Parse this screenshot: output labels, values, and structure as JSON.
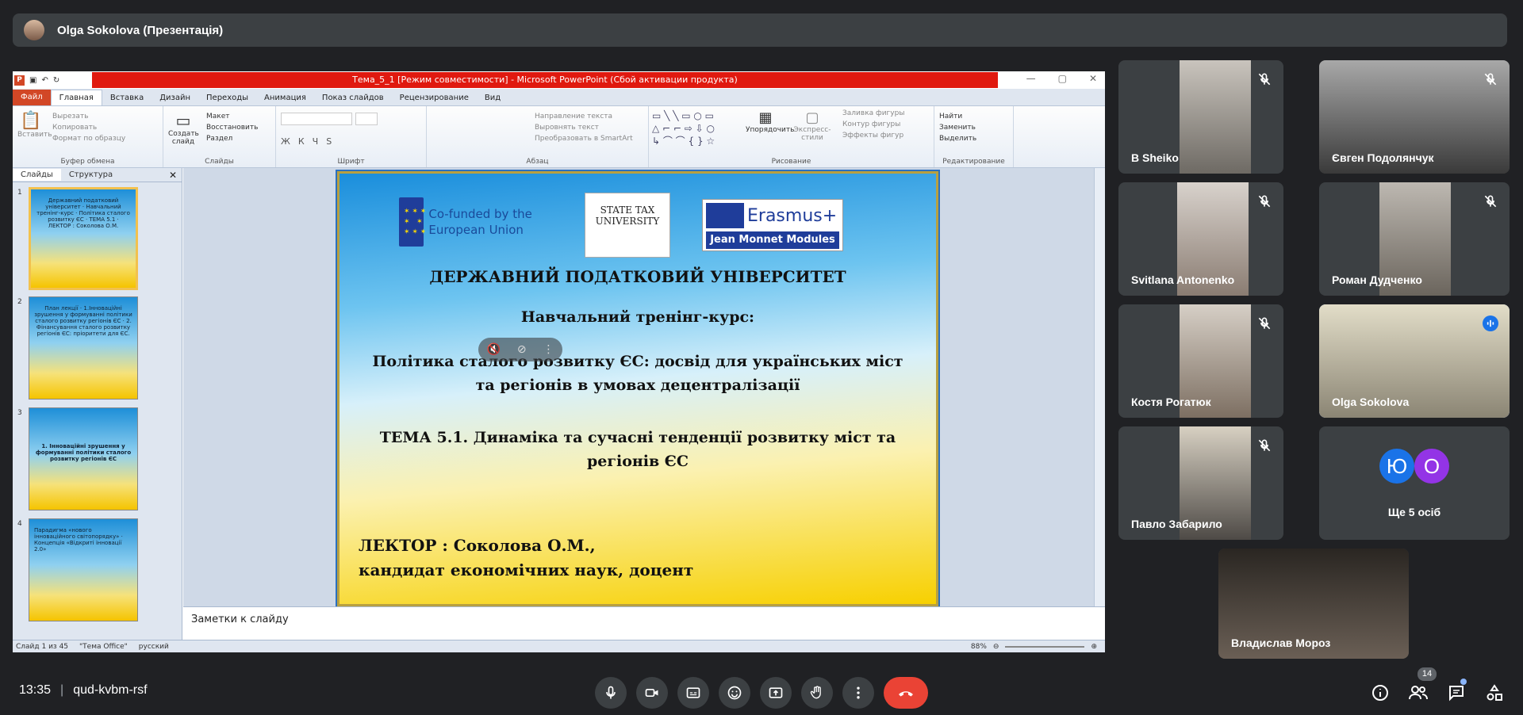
{
  "meeting": {
    "presenter_label": "Olga Sokolova (Презентація)",
    "time": "13:35",
    "code": "qud-kvbm-rsf",
    "people_count": "14"
  },
  "ppt": {
    "window_title": "Тема_5_1 [Режим совместимости] - Microsoft PowerPoint (Сбой активации продукта)",
    "tabs": [
      "Файл",
      "Главная",
      "Вставка",
      "Дизайн",
      "Переходы",
      "Анимация",
      "Показ слайдов",
      "Рецензирование",
      "Вид"
    ],
    "ribbon": {
      "clipboard": {
        "paste": "Вставить",
        "cut": "Вырезать",
        "copy": "Копировать",
        "format": "Формат по образцу",
        "label": "Буфер обмена"
      },
      "slides": {
        "create": "Создать слайд",
        "layout": "Макет",
        "reset": "Восстановить",
        "section": "Раздел",
        "label": "Слайды"
      },
      "font": {
        "label": "Шрифт"
      },
      "paragraph": {
        "direction": "Направление текста",
        "align": "Выровнять текст",
        "smartart": "Преобразовать в SmartArt",
        "label": "Абзац"
      },
      "drawing": {
        "arrange": "Упорядочить",
        "styles": "Экспресс-стили",
        "fill": "Заливка фигуры",
        "outline": "Контур фигуры",
        "effects": "Эффекты фигур",
        "label": "Рисование"
      },
      "editing": {
        "find": "Найти",
        "replace": "Заменить",
        "select": "Выделить",
        "label": "Редактирование"
      }
    },
    "panel_tabs": [
      "Слайды",
      "Структура"
    ],
    "thumbs": [
      {
        "num": "1",
        "text": "Державний податковий університет · Навчальний тренінг-курс · Політика сталого розвитку ЄС · ТЕМА 5.1 · ЛЕКТОР : Соколова О.М."
      },
      {
        "num": "2",
        "text": "План лекції · 1.Інноваційні зрушення у формуванні політики сталого розвитку регіонів ЄС · 2. Фінансування сталого розвитку регіонів ЄС: пріоритети для ЄС."
      },
      {
        "num": "3",
        "text": "1. Інноваційні зрушення у формуванні політики сталого розвитку регіонів ЄС"
      },
      {
        "num": "4",
        "text": "Парадигма «нового інноваційного світопорядку» · Концепція «Відкриті інновації 2.0»"
      }
    ],
    "slide": {
      "eu_logo_text": "Co-funded by the European Union",
      "university_logo": "STATE TAX UNIVERSITY",
      "erasmus_name": "Erasmus+",
      "erasmus_sub": "Jean Monnet Modules",
      "university": "ДЕРЖАВНИЙ ПОДАТКОВИЙ УНІВЕРСИТЕТ",
      "course": "Навчальний тренінг-курс:",
      "policy": "Політика сталого розвитку ЄС: досвід для українських міст та регіонів в умовах децентралізації",
      "topic": "ТЕМА 5.1. Динаміка та сучасні тенденції розвитку міст та регіонів ЄС",
      "lector": "ЛЕКТОР : Соколова О.М.,",
      "degree": "кандидат економічних наук, доцент"
    },
    "notes_placeholder": "Заметки к слайду",
    "status": {
      "slide": "Слайд 1 из 45",
      "theme": "\"Тема Office\"",
      "lang": "русский",
      "zoom": "88%"
    }
  },
  "participants": [
    {
      "name": "B Sheiko",
      "muted": true
    },
    {
      "name": "Євген Подолянчук",
      "muted": true
    },
    {
      "name": "Svitlana Antonenko",
      "muted": true
    },
    {
      "name": "Роман Дудченко",
      "muted": true
    },
    {
      "name": "Костя Рогатюк",
      "muted": true
    },
    {
      "name": "Olga Sokolova",
      "speaking": true
    },
    {
      "name": "Павло Забарило",
      "muted": true
    },
    {
      "name": "Владислав Мороз"
    }
  ],
  "others": {
    "avatars": [
      "Ю",
      "О"
    ],
    "avatar_colors": [
      "#1a73e8",
      "#9334e6"
    ],
    "label": "Ще 5 осіб"
  },
  "colors": {
    "end_call": "#ea4335",
    "accent": "#8ab4f8"
  }
}
